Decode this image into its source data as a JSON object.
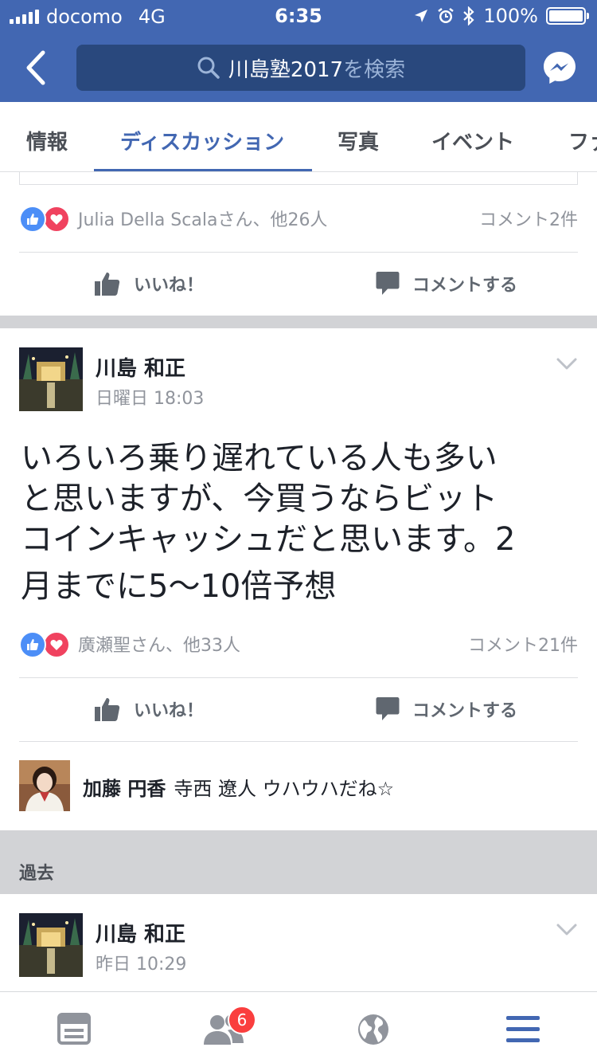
{
  "status_bar": {
    "carrier": "docomo",
    "network": "4G",
    "time": "6:35",
    "battery": "100%"
  },
  "header": {
    "search_query": "川島塾2017",
    "search_suffix": "を検索"
  },
  "tabs": [
    {
      "label": "情報",
      "active": false
    },
    {
      "label": "ディスカッション",
      "active": true
    },
    {
      "label": "写真",
      "active": false
    },
    {
      "label": "イベント",
      "active": false
    },
    {
      "label": "ファ",
      "active": false
    }
  ],
  "prev_post": {
    "reactions_text": "Julia Della Scalaさん、他26人",
    "comment_count": "コメント2件"
  },
  "actions": {
    "like": "いいね！",
    "comment": "コメントする"
  },
  "post": {
    "author": "川島 和正",
    "time": "日曜日 18:03",
    "body_lines": [
      "いろいろ乗り遅れている人も多い",
      "と思いますが、今買うならビット",
      "コインキャッシュだと思います。2",
      "月までに5〜10倍予想"
    ],
    "reactions_text": "廣瀬聖さん、他33人",
    "comment_count": "コメント21件",
    "comment": {
      "author": "加藤 円香",
      "text": "寺西 遼人 ウハウハだね☆"
    }
  },
  "past_section": {
    "label": "過去",
    "post": {
      "author": "川島 和正",
      "time": "昨日 10:29"
    }
  },
  "bottom_nav": {
    "friends_badge": "6"
  },
  "colors": {
    "brand": "#4267b2",
    "like": "#4c8ef7",
    "love": "#f0425f",
    "badge": "#fa3e3e"
  }
}
